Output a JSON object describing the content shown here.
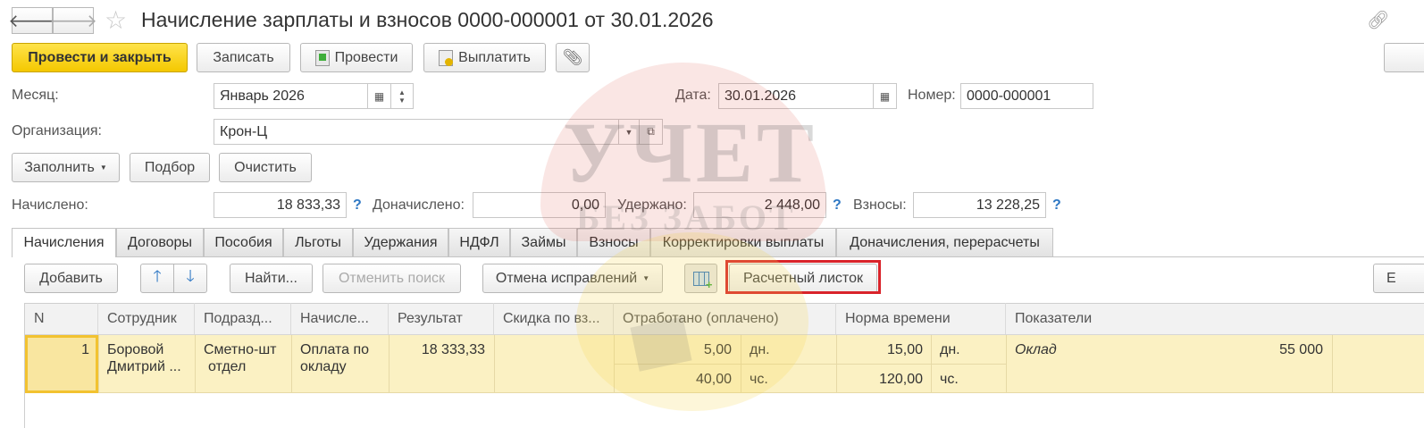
{
  "window": {
    "title": "Начисление зарплаты и взносов 0000-000001 от 30.01.2026"
  },
  "toolbar": {
    "post_close": "Провести и закрыть",
    "save": "Записать",
    "post": "Провести",
    "pay": "Выплатить"
  },
  "form": {
    "month_label": "Месяц:",
    "month_value": "Январь 2026",
    "date_label": "Дата:",
    "date_value": "30.01.2026",
    "number_label": "Номер:",
    "number_value": "0000-000001",
    "org_label": "Организация:",
    "org_value": "Крон-Ц"
  },
  "actions": {
    "fill": "Заполнить",
    "select": "Подбор",
    "clear": "Очистить"
  },
  "totals": {
    "accrued_label": "Начислено:",
    "accrued_value": "18 833,33",
    "extra_label": "Доначислено:",
    "extra_value": "0,00",
    "withheld_label": "Удержано:",
    "withheld_value": "2 448,00",
    "contrib_label": "Взносы:",
    "contrib_value": "13 228,25",
    "help": "?"
  },
  "tabs": [
    "Начисления",
    "Договоры",
    "Пособия",
    "Льготы",
    "Удержания",
    "НДФЛ",
    "Займы",
    "Взносы",
    "Корректировки выплаты",
    "Доначисления, перерасчеты"
  ],
  "table_toolbar": {
    "add": "Добавить",
    "find": "Найти...",
    "cancel_search": "Отменить поиск",
    "cancel_fix": "Отмена исправлений",
    "payslip": "Расчетный листок",
    "more": "Е"
  },
  "table": {
    "headers": [
      "N",
      "Сотрудник",
      "Подразд...",
      "Начисле...",
      "Результат",
      "Скидка по вз...",
      "Отработано (оплачено)",
      "Норма времени",
      "Показатели"
    ],
    "row": {
      "n": "1",
      "employee_1": "Боровой",
      "employee_2": "Дмитрий ...",
      "dept_1": "Сметно-шт",
      "dept_2": "отдел",
      "accrual_1": "Оплата по",
      "accrual_2": "окладу",
      "result": "18 333,33",
      "worked_days": "5,00",
      "worked_days_unit": "дн.",
      "worked_hours": "40,00",
      "worked_hours_unit": "чс.",
      "norm_days": "15,00",
      "norm_days_unit": "дн.",
      "norm_hours": "120,00",
      "norm_hours_unit": "чс.",
      "indicator": "Оклад",
      "indicator_value": "55 000"
    }
  },
  "watermark": {
    "line1": "УЧЕТ",
    "line2": "БЕЗ ЗАБОТ"
  },
  "colors": {
    "primary_button": "#f4c800",
    "selected_row": "#fbf1c3",
    "highlight_frame": "#d9232a",
    "help_blue": "#2f78c4"
  }
}
